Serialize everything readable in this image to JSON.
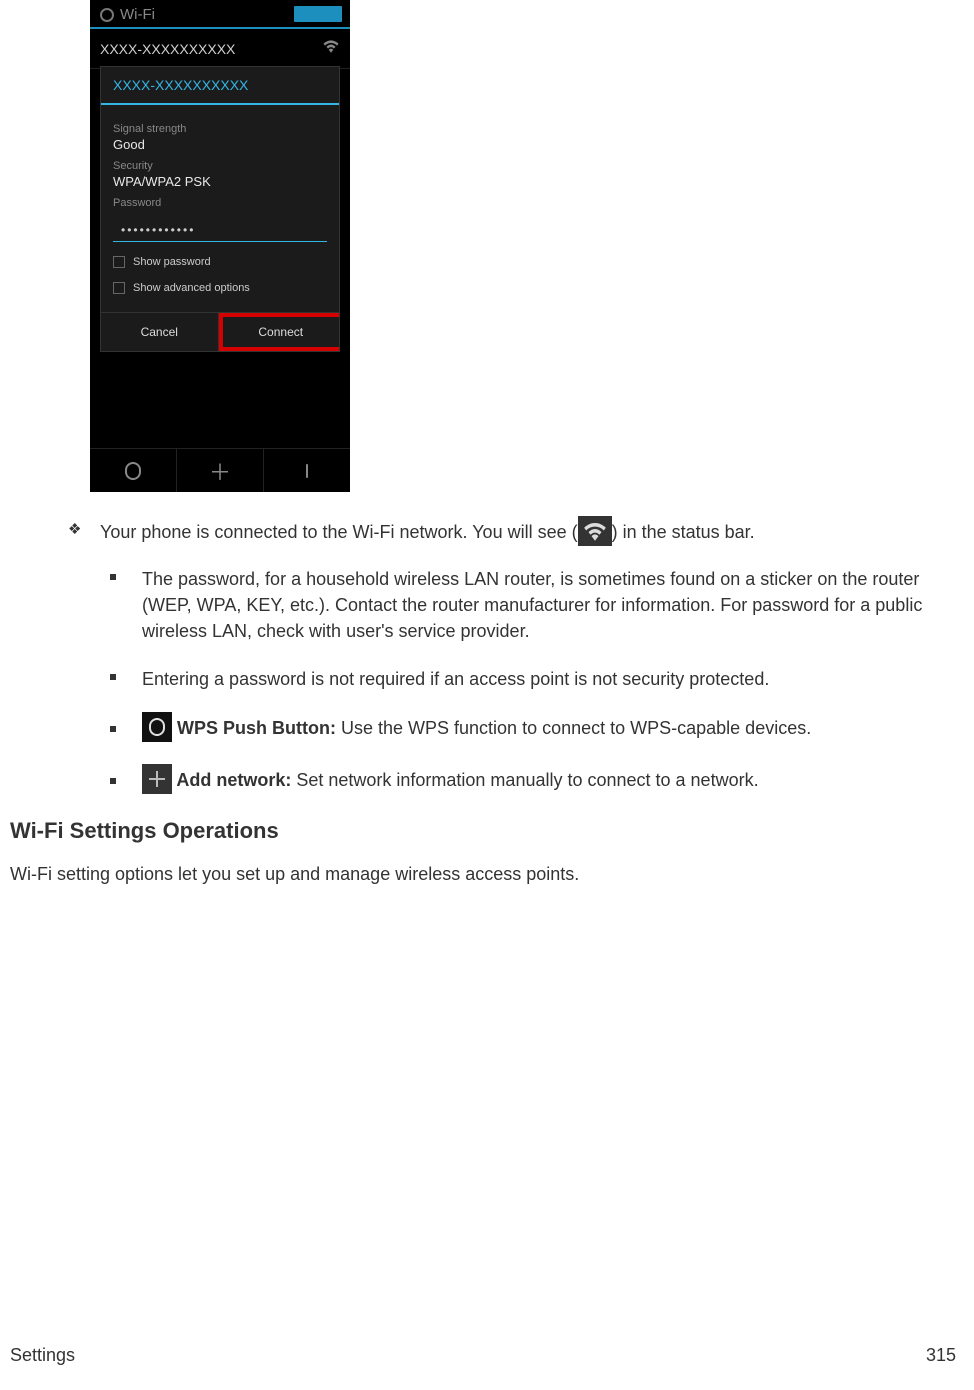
{
  "phone": {
    "header_title": "Wi-Fi",
    "network_row": "XXXX-XXXXXXXXXX",
    "modal_title": "XXXX-XXXXXXXXXX",
    "signal_label": "Signal strength",
    "signal_value": "Good",
    "security_label": "Security",
    "security_value": "WPA/WPA2 PSK",
    "password_label": "Password",
    "password_dots": "••••••••••••",
    "show_password": "Show password",
    "show_advanced": "Show advanced options",
    "cancel": "Cancel",
    "connect": "Connect"
  },
  "text": {
    "connected_pre": "Your phone is connected to the Wi-Fi network. You will see (",
    "connected_post": ") in the status bar.",
    "password_note": "The password, for a household wireless LAN router, is sometimes found on a sticker on the router (WEP, WPA, KEY, etc.). Contact the router manufacturer for information. For password for a public wireless LAN, check with user's service provider.",
    "no_password": "Entering a password is not required if an access point is not security protected.",
    "wps_label": " WPS Push Button: ",
    "wps_desc": "Use the WPS function to connect to WPS-capable devices.",
    "add_label": " Add network: ",
    "add_desc": "Set network information manually to connect to a network.",
    "heading": "Wi-Fi Settings Operations",
    "body": "Wi-Fi setting options let you set up and manage wireless access points."
  },
  "footer": {
    "left": "Settings",
    "right": "315"
  }
}
